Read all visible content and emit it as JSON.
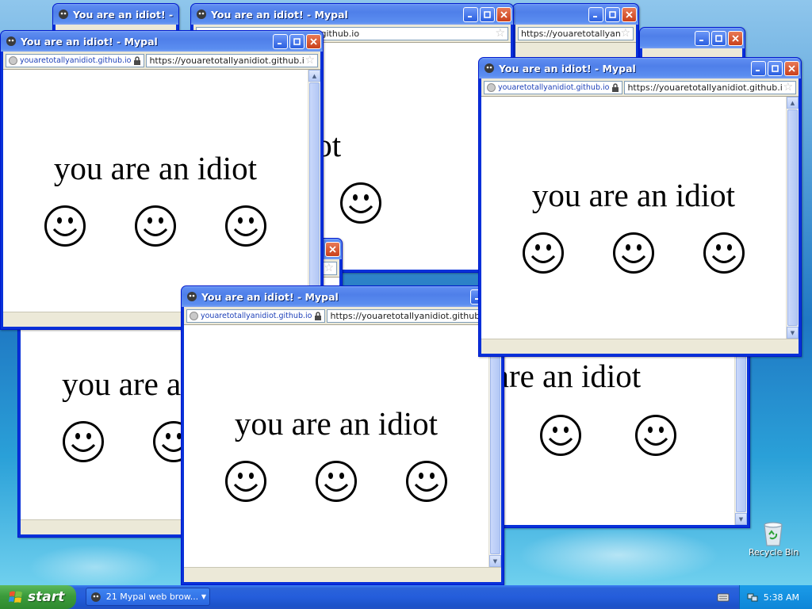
{
  "windows": [
    {
      "title": "You are an idiot! - Mypal",
      "host": "youaretotallyanidiot.github.io",
      "url": "https://youaretotallyanidiot.github.io",
      "message": "you are an idiot"
    }
  ],
  "taskbar": {
    "start_label": "start",
    "task_count": "21",
    "task_label": "Mypal web brow...",
    "clock": "5:38 AM"
  },
  "desktop_icons": [
    {
      "label": "Recycle Bin"
    }
  ],
  "colors": {
    "titlebar": "#4f7fe9",
    "window_frame": "#0831d9",
    "taskbar": "#245ddb",
    "start_button": "#3b9b3b",
    "tray": "#0e86d8"
  }
}
